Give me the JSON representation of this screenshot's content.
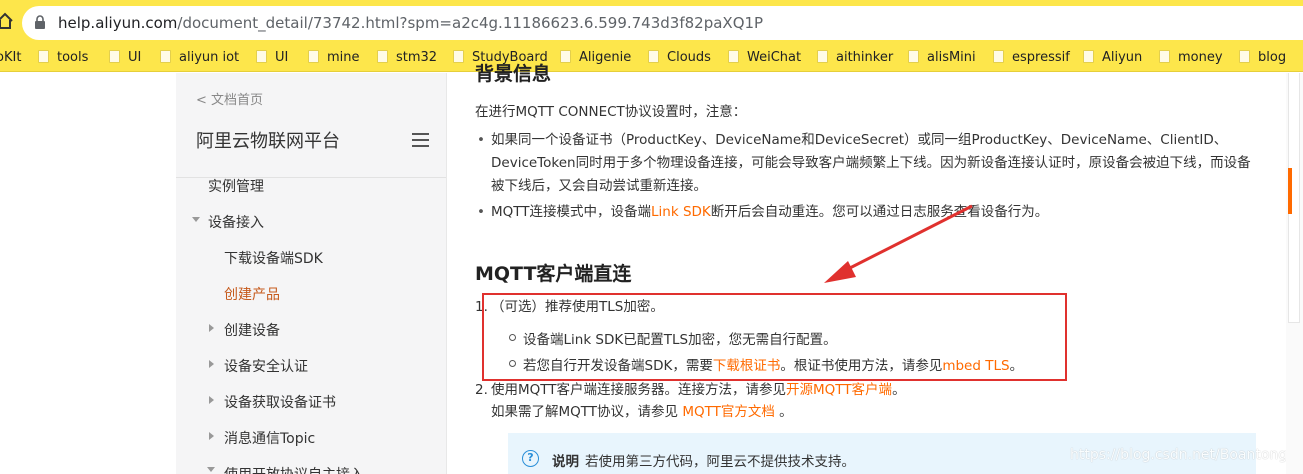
{
  "browser": {
    "url_host": "help.aliyun.com",
    "url_path": "/document_detail/73742.html?spm=a2c4g.11186623.6.599.743d3f82paXQ1P",
    "bookmarks": [
      "oKIt",
      "tools",
      "UI",
      "aliyun iot",
      "UI",
      "mine",
      "stm32",
      "StudyBoard",
      "Aligenie",
      "Clouds",
      "WeiChat",
      "aithinker",
      "alisMini",
      "espressif",
      "Aliyun",
      "money",
      "blog"
    ]
  },
  "sidebar": {
    "back_label": "< 文档首页",
    "title": "阿里云物联网平台",
    "items": [
      {
        "label": "实例管理"
      },
      {
        "label": "设备接入"
      },
      {
        "label": "下载设备端SDK"
      },
      {
        "label": "创建产品"
      },
      {
        "label": "创建设备"
      },
      {
        "label": "设备安全认证"
      },
      {
        "label": "设备获取设备证书"
      },
      {
        "label": "消息通信Topic"
      },
      {
        "label": "使用开放协议自主接入"
      }
    ]
  },
  "content": {
    "cut_heading": "背景信息",
    "intro": "在进行MQTT CONNECT协议设置时，注意：",
    "bullet1": "如果同一个设备证书（ProductKey、DeviceName和DeviceSecret）或同一组ProductKey、DeviceName、ClientID、DeviceToken同时用于多个物理设备连接，可能会导致客户端频繁上下线。因为新设备连接认证时，原设备会被迫下线，而设备被下线后，又会自动尝试重新连接。",
    "bullet2_pre": "MQTT连接模式中，设备端",
    "bullet2_link": "Link SDK",
    "bullet2_post": "断开后会自动重连。您可以通过日志服务查看设备行为。",
    "h2": "MQTT客户端直连",
    "step1_num": "1.",
    "step1": "（可选）推荐使用TLS加密。",
    "sub1": "设备端Link SDK已配置TLS加密，您无需自行配置。",
    "sub2_pre": "若您自行开发设备端SDK，需要",
    "sub2_link1": "下载根证书",
    "sub2_mid": "。根证书使用方法，请参见",
    "sub2_link2": "mbed TLS",
    "sub2_post": "。",
    "step2_num": "2.",
    "step2_pre": "使用MQTT客户端连接服务器。连接方法，请参见",
    "step2_link": "开源MQTT客户端",
    "step2_post": "。",
    "step2_line2_pre": "如果需了解MQTT协议，请参见 ",
    "step2_line2_link": "MQTT官方文档",
    "step2_line2_post": " 。",
    "note_label": "说明",
    "note_text": "若使用第三方代码，阿里云不提供技术支持。",
    "watermark": "https://blog.csdn.net/Boantong_"
  },
  "colors": {
    "accent": "#ff6a00",
    "highlight": "#e0312e",
    "toolbar": "#fde64b"
  }
}
